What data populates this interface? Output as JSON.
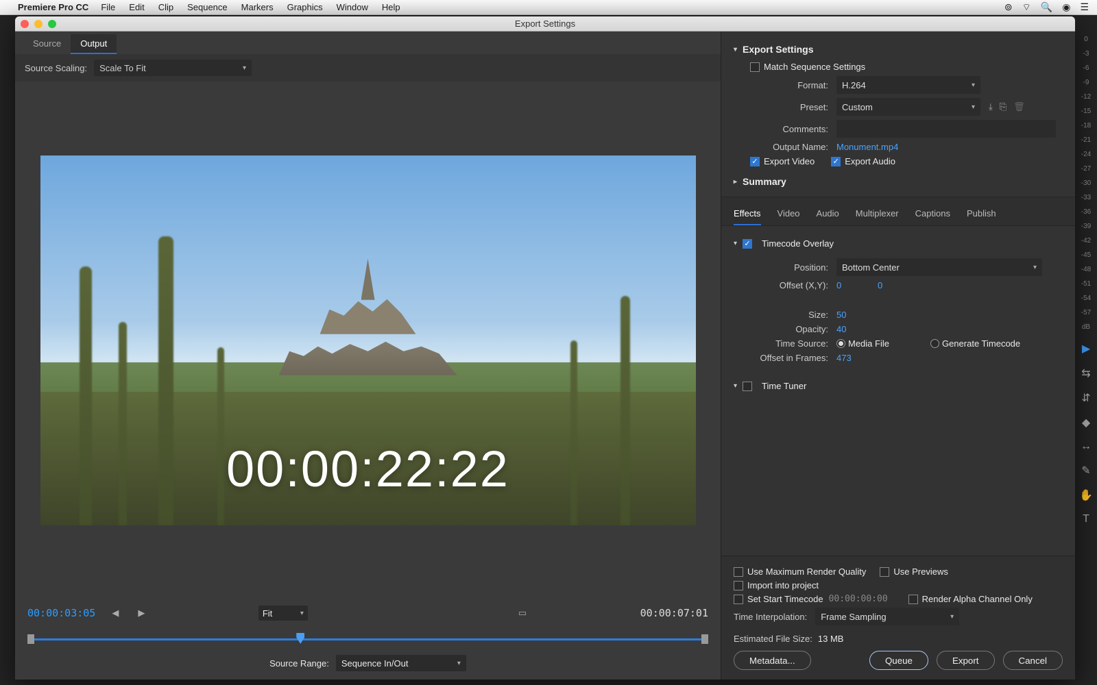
{
  "menubar": {
    "app": "Premiere Pro CC",
    "items": [
      "File",
      "Edit",
      "Clip",
      "Sequence",
      "Markers",
      "Graphics",
      "Window",
      "Help"
    ]
  },
  "window_title": "Export Settings",
  "left": {
    "tabs": {
      "source": "Source",
      "output": "Output"
    },
    "source_scaling_label": "Source Scaling:",
    "source_scaling_value": "Scale To Fit",
    "timecode_overlay": "00:00:22:22",
    "tc_current": "00:00:03:05",
    "tc_total": "00:00:07:01",
    "fit_label": "Fit",
    "source_range_label": "Source Range:",
    "source_range_value": "Sequence In/Out"
  },
  "export_settings": {
    "header": "Export Settings",
    "match_seq": "Match Sequence Settings",
    "format_label": "Format:",
    "format_value": "H.264",
    "preset_label": "Preset:",
    "preset_value": "Custom",
    "comments_label": "Comments:",
    "comments_value": "",
    "outputname_label": "Output Name:",
    "outputname_value": "Monument.mp4",
    "export_video": "Export Video",
    "export_audio": "Export Audio",
    "summary": "Summary"
  },
  "tabs2": [
    "Effects",
    "Video",
    "Audio",
    "Multiplexer",
    "Captions",
    "Publish"
  ],
  "timecode_overlay_panel": {
    "header": "Timecode Overlay",
    "position_label": "Position:",
    "position_value": "Bottom Center",
    "offset_label": "Offset (X,Y):",
    "offset_x": "0",
    "offset_y": "0",
    "size_label": "Size:",
    "size_value": "50",
    "opacity_label": "Opacity:",
    "opacity_value": "40",
    "timesource_label": "Time Source:",
    "timesource_media": "Media File",
    "timesource_gen": "Generate Timecode",
    "offset_frames_label": "Offset in Frames:",
    "offset_frames_value": "473"
  },
  "time_tuner_header": "Time Tuner",
  "footer": {
    "maxrender": "Use Maximum Render Quality",
    "previews": "Use Previews",
    "import": "Import into project",
    "setstart": "Set Start Timecode",
    "setstart_tc": "00:00:00:00",
    "alpha": "Render Alpha Channel Only",
    "timeinterp_label": "Time Interpolation:",
    "timeinterp_value": "Frame Sampling",
    "est_label": "Estimated File Size:",
    "est_value": "13 MB",
    "metadata": "Metadata...",
    "queue": "Queue",
    "export": "Export",
    "cancel": "Cancel"
  },
  "db_ticks": [
    "0",
    "-3",
    "-6",
    "-9",
    "-12",
    "-15",
    "-18",
    "-21",
    "-24",
    "-27",
    "-30",
    "-33",
    "-36",
    "-39",
    "-42",
    "-45",
    "-48",
    "-51",
    "-54",
    "-57",
    "dB"
  ]
}
